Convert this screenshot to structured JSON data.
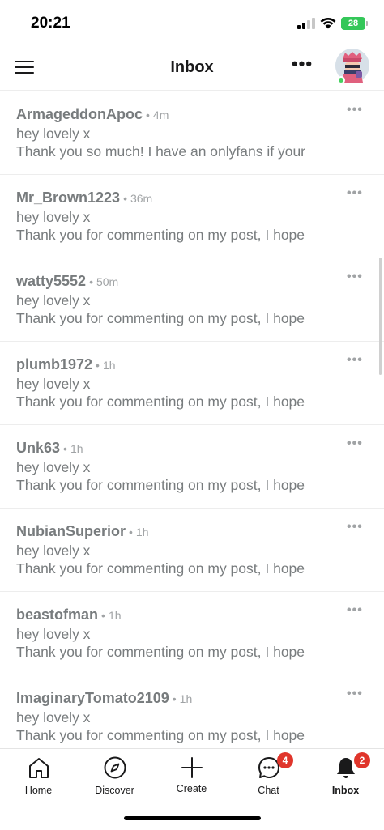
{
  "status_bar": {
    "time": "20:21",
    "battery": "28"
  },
  "header": {
    "title": "Inbox",
    "menu_icon": "hamburger-menu-icon",
    "more_icon": "more-horizontal-icon",
    "more_glyph": "•••"
  },
  "messages": [
    {
      "username": "ArmageddonApoc",
      "time": "4m",
      "subject": "hey lovely x",
      "body": "Thank you so much! I have an onlyfans if your"
    },
    {
      "username": "Mr_Brown1223",
      "time": "36m",
      "subject": "hey lovely x",
      "body": "Thank you for commenting on my post, I hope"
    },
    {
      "username": "watty5552",
      "time": "50m",
      "subject": "hey lovely x",
      "body": "Thank you for commenting on my post, I hope"
    },
    {
      "username": "plumb1972",
      "time": "1h",
      "subject": "hey lovely x",
      "body": "Thank you for commenting on my post, I hope"
    },
    {
      "username": "Unk63",
      "time": "1h",
      "subject": "hey lovely x",
      "body": "Thank you for commenting on my post, I hope"
    },
    {
      "username": "NubianSuperior",
      "time": "1h",
      "subject": "hey lovely x",
      "body": "Thank you for commenting on my post, I hope"
    },
    {
      "username": "beastofman",
      "time": "1h",
      "subject": "hey lovely x",
      "body": "Thank you for commenting on my post, I hope"
    },
    {
      "username": "ImaginaryTomato2109",
      "time": "1h",
      "subject": "hey lovely x",
      "body": "Thank you for commenting on my post, I hope"
    }
  ],
  "separator": "•",
  "item_more_glyph": "•••",
  "tabs": [
    {
      "label": "Home",
      "icon": "home-icon"
    },
    {
      "label": "Discover",
      "icon": "compass-icon"
    },
    {
      "label": "Create",
      "icon": "plus-icon"
    },
    {
      "label": "Chat",
      "icon": "chat-bubble-icon",
      "badge": "4"
    },
    {
      "label": "Inbox",
      "icon": "bell-icon",
      "badge": "2",
      "active": true
    }
  ],
  "colors": {
    "badge": "#e0352b",
    "online": "#46d160",
    "battery": "#34c759",
    "muted_text": "#787c7e"
  }
}
